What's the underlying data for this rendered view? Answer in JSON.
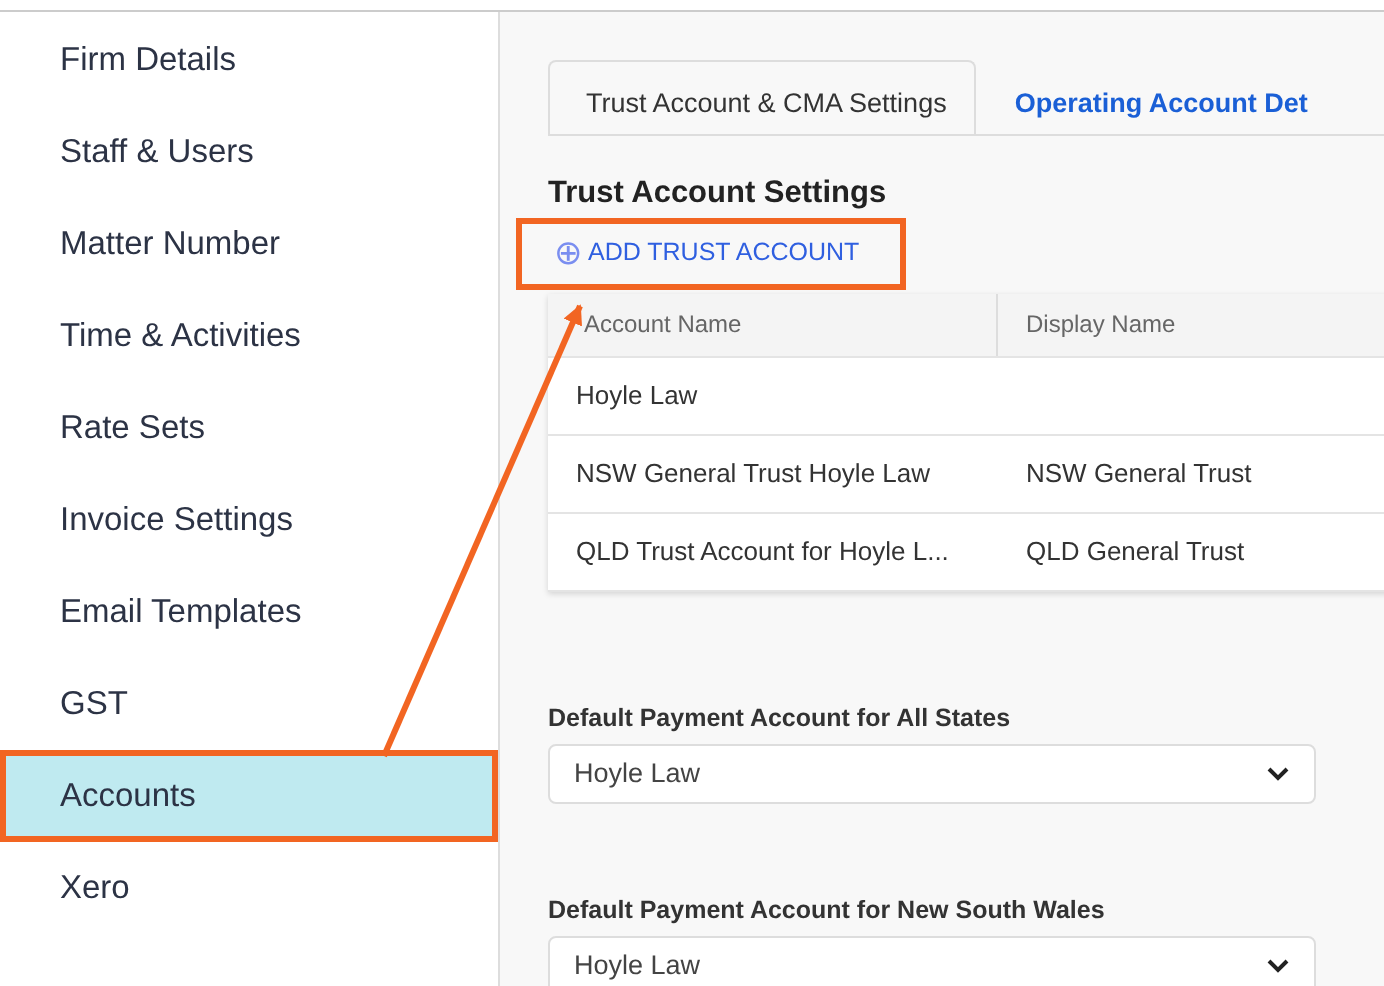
{
  "sidebar": {
    "items": [
      {
        "label": "Firm Details",
        "selected": false,
        "highlighted": false
      },
      {
        "label": "Staff & Users",
        "selected": false,
        "highlighted": false
      },
      {
        "label": "Matter Number",
        "selected": false,
        "highlighted": false
      },
      {
        "label": "Time & Activities",
        "selected": false,
        "highlighted": false
      },
      {
        "label": "Rate Sets",
        "selected": false,
        "highlighted": false
      },
      {
        "label": "Invoice Settings",
        "selected": false,
        "highlighted": false
      },
      {
        "label": "Email Templates",
        "selected": false,
        "highlighted": false
      },
      {
        "label": "GST",
        "selected": false,
        "highlighted": false
      },
      {
        "label": "Accounts",
        "selected": true,
        "highlighted": true
      },
      {
        "label": "Xero",
        "selected": false,
        "highlighted": false
      }
    ]
  },
  "tabs": [
    {
      "label": "Trust Account & CMA Settings",
      "selected": true
    },
    {
      "label": "Operating Account Det",
      "selected": false
    }
  ],
  "section_title": "Trust Account Settings",
  "add_button": {
    "icon": "⊕",
    "label": "ADD TRUST ACCOUNT",
    "highlighted": true
  },
  "table": {
    "columns": [
      "Account Name",
      "Display Name"
    ],
    "rows": [
      [
        "Hoyle Law",
        ""
      ],
      [
        "NSW General Trust Hoyle Law",
        "NSW General Trust"
      ],
      [
        "QLD Trust Account for Hoyle L...",
        "QLD General Trust"
      ]
    ]
  },
  "fields": [
    {
      "label": "Default Payment Account for All States",
      "value": "Hoyle Law"
    },
    {
      "label": "Default Payment Account for New South Wales",
      "value": "Hoyle Law"
    }
  ]
}
